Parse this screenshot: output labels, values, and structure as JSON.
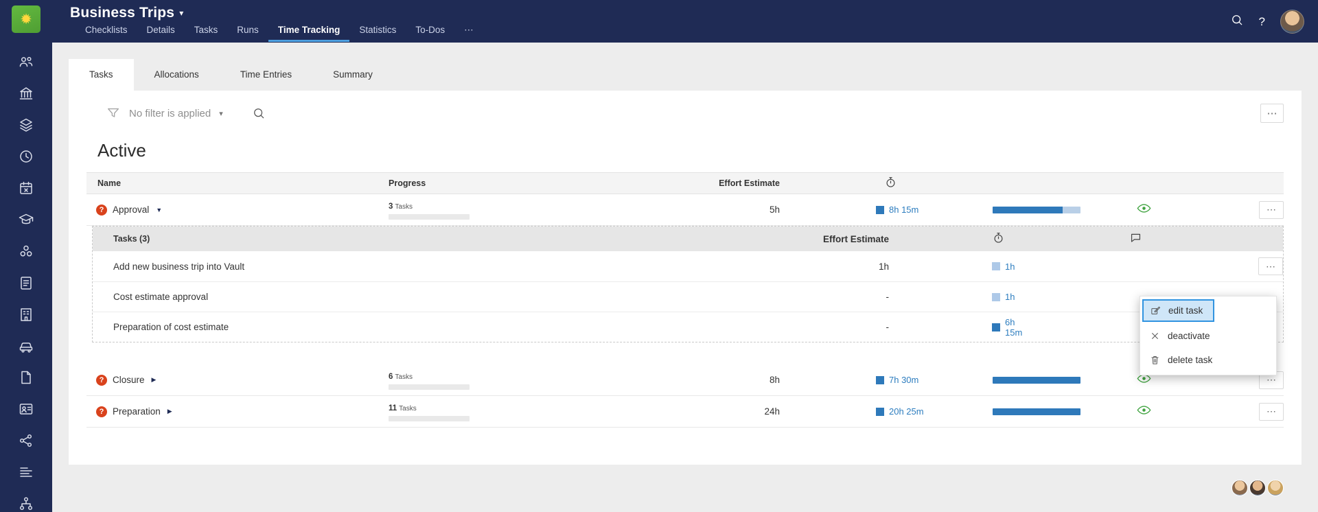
{
  "colors": {
    "navy": "#1f2b55",
    "tab_underline": "#4ea0e0",
    "link_blue": "#2d7dbf",
    "light_blue": "#aec9e8",
    "bar_fill": "#2e79ba",
    "bar_rest": "#b9cfe7",
    "red": "#d9421c",
    "green": "#3fa33f",
    "sel_bg": "#cfe6f8",
    "sel_border": "#3093e0",
    "logo_green": "#63b940",
    "logo_yellow": "#ffd83d"
  },
  "icons": {
    "logo_glyph": "✹",
    "more": "⋯",
    "caret_small": "▾",
    "caret_down": "▼",
    "caret_right": "▶",
    "help": "?",
    "question": "?"
  },
  "header": {
    "title": "Business Trips",
    "tabs": [
      "Checklists",
      "Details",
      "Tasks",
      "Runs",
      "Time Tracking",
      "Statistics",
      "To-Dos"
    ],
    "active_tab": "Time Tracking"
  },
  "subtabs": [
    "Tasks",
    "Allocations",
    "Time Entries",
    "Summary"
  ],
  "filter": {
    "label": "No filter is applied"
  },
  "section": {
    "title": "Active"
  },
  "table": {
    "columns": {
      "name": "Name",
      "progress": "Progress",
      "effort": "Effort Estimate"
    },
    "groups": [
      {
        "name": "Approval",
        "tasks_count": "3",
        "tasks_word": "Tasks",
        "effort": "5h",
        "time": "8h 15m",
        "time_tone": "dark",
        "progress_pct": 80,
        "expanded": true
      },
      {
        "name": "Closure",
        "tasks_count": "6",
        "tasks_word": "Tasks",
        "effort": "8h",
        "time": "7h 30m",
        "time_tone": "dark",
        "progress_pct": 100,
        "expanded": false
      },
      {
        "name": "Preparation",
        "tasks_count": "11",
        "tasks_word": "Tasks",
        "effort": "24h",
        "time": "20h 25m",
        "time_tone": "dark",
        "progress_pct": 100,
        "expanded": false
      }
    ],
    "subtable": {
      "title": "Tasks (3)",
      "effort_header": "Effort Estimate",
      "rows": [
        {
          "name": "Add new business trip into Vault",
          "effort": "1h",
          "time": "1h",
          "time_tone": "light"
        },
        {
          "name": "Cost estimate approval",
          "effort": "-",
          "time": "1h",
          "time_tone": "light"
        },
        {
          "name": "Preparation of cost estimate",
          "effort": "-",
          "time": "6h 15m",
          "time_tone": "dark"
        }
      ]
    }
  },
  "context_menu": {
    "items": [
      {
        "label": "edit task",
        "selected": true
      },
      {
        "label": "deactivate",
        "selected": false
      },
      {
        "label": "delete task",
        "selected": false
      }
    ]
  }
}
